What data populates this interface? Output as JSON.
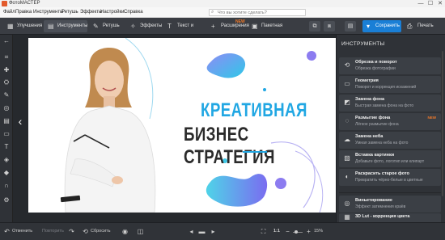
{
  "app": {
    "title": "ФотоМАСТЕР"
  },
  "window_controls": {
    "minimize": "—",
    "maximize": "☐",
    "close": "✕"
  },
  "menu": {
    "items": [
      "Файл",
      "Правка",
      "Инструменты",
      "Ретушь",
      "Эффекты",
      "Настройки",
      "Справка"
    ],
    "search_placeholder": "Что вы хотите сделать?"
  },
  "toolbar": {
    "tabs": [
      {
        "label": "Улучшения",
        "icon": "▦"
      },
      {
        "label": "Инструменты",
        "icon": "▤"
      },
      {
        "label": "Ретушь",
        "icon": "✎"
      },
      {
        "label": "Эффекты",
        "icon": "✧"
      },
      {
        "label": "Текст и рамки",
        "icon": "T"
      },
      {
        "label": "Расширения",
        "icon": "+"
      },
      {
        "label": "Пакетная обработка",
        "icon": "▣"
      }
    ],
    "new_badge": "NEW",
    "save_label": "Сохранить",
    "print_label": "Печать"
  },
  "canvas": {
    "headline_line1": "КРЕАТИВНАЯ",
    "headline_line2": "БИЗНЕС СТРАТЕГИЯ",
    "accent_color": "#21a7e3"
  },
  "right_panel": {
    "title": "ИНСТРУМЕНТЫ",
    "tools": [
      {
        "title": "Обрезка и поворот",
        "subtitle": "Обрезка фотографии",
        "icon": "⟲",
        "new": ""
      },
      {
        "title": "Геометрия",
        "subtitle": "Поворот и коррекция искажений",
        "icon": "▭",
        "new": ""
      },
      {
        "title": "Замена фона",
        "subtitle": "Быстрая замена фона на фото",
        "icon": "◩",
        "new": ""
      },
      {
        "title": "Размытие фона",
        "subtitle": "Лёгкое размытие фона",
        "icon": "◌",
        "new": "NEW"
      },
      {
        "title": "Замена неба",
        "subtitle": "Умная замена неба на фото",
        "icon": "☁",
        "new": ""
      },
      {
        "title": "Вставка картинки",
        "subtitle": "Добавьте фото, логотип или клипарт",
        "icon": "▨",
        "new": ""
      },
      {
        "title": "Раскрасить старое фото",
        "subtitle": "Превратить чёрно-белые в цветные",
        "icon": "◐",
        "new": ""
      },
      {
        "title": "Виньетирование",
        "subtitle": "Эффект затемнения краёв",
        "icon": "◎",
        "new": ""
      },
      {
        "title": "3D Lut - коррекция цвета",
        "subtitle": "Готовые стили и загрузка пресетов",
        "icon": "▦",
        "new": ""
      }
    ]
  },
  "bottom_bar": {
    "undo_label": "Отменить",
    "redo_label": "Повторить",
    "reset_label": "Сбросить",
    "ratio_label": "1:1",
    "zoom_label": "15%"
  }
}
